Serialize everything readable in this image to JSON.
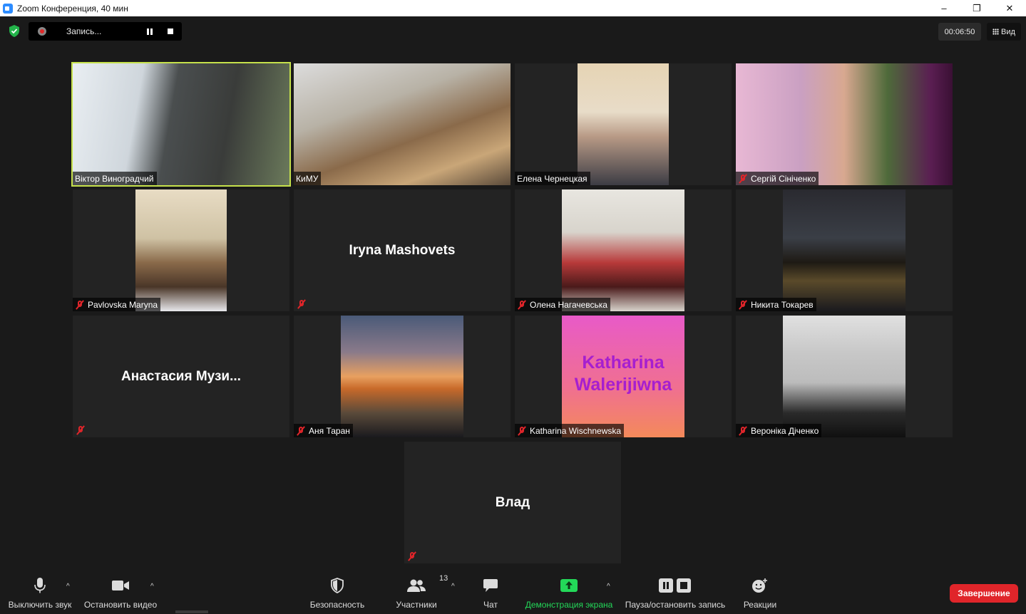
{
  "window": {
    "title": "Zoom Конференция, 40 мин",
    "minimize": "–",
    "maximize": "❐",
    "close": "✕"
  },
  "topbar": {
    "recording_label": "Запись...",
    "timer": "00:06:50",
    "view_label": "Вид"
  },
  "participants": [
    {
      "name": "Віктор Виноградчий"
    },
    {
      "name": "КиМУ"
    },
    {
      "name": "Елена Чернецкая"
    },
    {
      "name": "Сергій Сініченко"
    },
    {
      "name": "Pavlovska Maryna"
    },
    {
      "display": "Iryna Mashovets"
    },
    {
      "name": "Олена Нагачевська"
    },
    {
      "name": "Никита Токарев"
    },
    {
      "display": "Анастасия  Музи..."
    },
    {
      "name": "Аня Таран"
    },
    {
      "name": "Katharina Wischnewska",
      "avatar_text": "Katharina Walerijiwna"
    },
    {
      "name": "Вероніка Діченко"
    },
    {
      "display": "Влад"
    }
  ],
  "toolbar": {
    "mute": "Выключить звук",
    "video": "Остановить видео",
    "security": "Безопасность",
    "participants": "Участники",
    "participants_count": "13",
    "chat": "Чат",
    "share": "Демонстрация экрана",
    "record": "Пауза/остановить запись",
    "reactions": "Реакции",
    "end": "Завершение",
    "caret": "^"
  },
  "colors": {
    "active_speaker": "#c6e14b",
    "share_green": "#23d959",
    "end_red": "#e0252a",
    "avatar_name": "#a61fcf"
  }
}
